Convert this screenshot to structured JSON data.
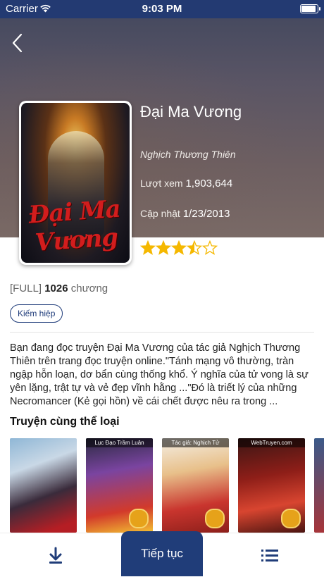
{
  "status_bar": {
    "carrier": "Carrier",
    "time": "9:03 PM"
  },
  "book": {
    "title": "Đại Ma Vương",
    "cover_text": "Đại Ma Vương",
    "author": "Nghịch Thương Thiên",
    "views_label": "Lượt xem",
    "views": "1,903,644",
    "updated_label": "Cập nhật",
    "updated": "1/23/2013",
    "rating": 3.5,
    "rating_max": 5,
    "status": "[FULL]",
    "chapter_count": "1026",
    "chapter_unit": "chương",
    "genre": "Kiếm hiệp",
    "description": "Bạn đang đọc truyện Đại Ma Vương của tác giả Nghịch Thương Thiên trên trang đọc truyện online.\"Tánh mạng vô thường, tràn ngập hỗn loạn, dơ bẩn cùng thống khổ. Ý nghĩa của tử vong là sự yên lặng, trật tự và vẻ đẹp vĩnh hằng ...\"Đó là triết lý của những Necromancer (Kẻ gọi hồn) về cái chết được nêu ra trong ..."
  },
  "same_genre": {
    "title": "Truyện cùng thể loại",
    "books": [
      {
        "caption": ""
      },
      {
        "caption": "Lục Đạo Trầm Luân"
      },
      {
        "caption": "Tác giả: Nghịch Tử"
      },
      {
        "caption": "WebTruyen.com"
      },
      {
        "caption": ""
      }
    ]
  },
  "tab_bar": {
    "continue_label": "Tiếp tục"
  },
  "colors": {
    "primary": "#203d79",
    "star": "#f5b800",
    "status_bar": "#233a72"
  }
}
